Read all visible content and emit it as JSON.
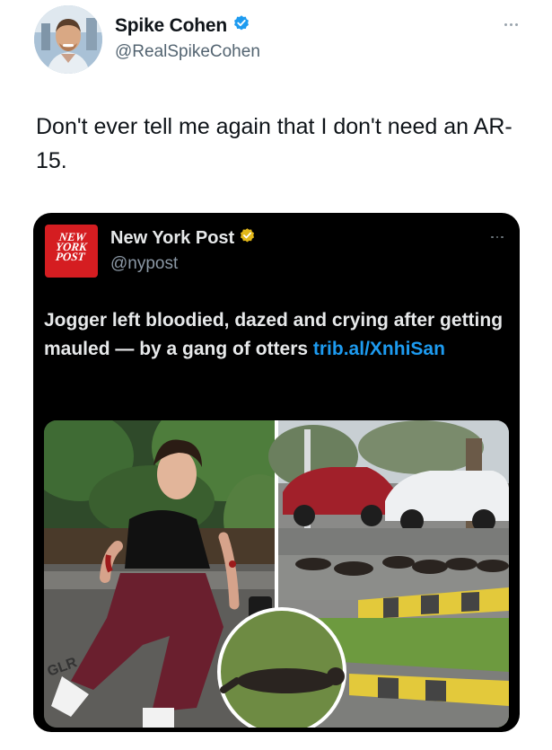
{
  "author": {
    "display_name": "Spike Cohen",
    "handle": "@RealSpikeCohen",
    "verified_badge_color": "#1d9bf0"
  },
  "tweet": {
    "text": "Don't ever tell me again that I don't need an AR-15."
  },
  "quoted": {
    "display_name": "New York Post",
    "handle": "@nypost",
    "verified_badge_color": "#e2b719",
    "logo_lines": [
      "NEW",
      "YORK",
      "POST"
    ],
    "text": "Jogger left bloodied, dazed and crying after getting mauled — by a gang of otters ",
    "link": "trib.al/XnhiSan",
    "link_color": "#1d9bf0",
    "media_sign_text": "GLR"
  },
  "icons": {
    "verified": "verified-badge-icon",
    "more": "more-options-icon"
  }
}
